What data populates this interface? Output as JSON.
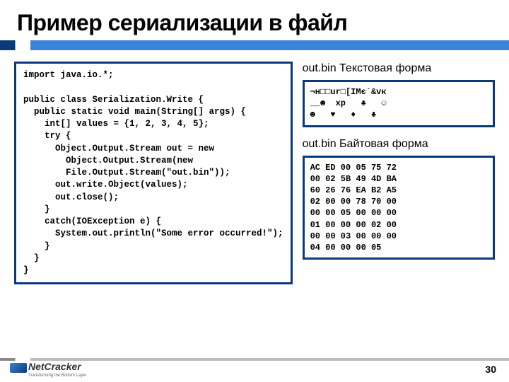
{
  "title": "Пример сериализации в файл",
  "code": "import java.io.*;\n\npublic class Serialization.Write {\n  public static void main(String[] args) {\n    int[] values = {1, 2, 3, 4, 5};\n    try {\n      Object.Output.Stream out = new\n        Object.Output.Stream(new\n        File.Output.Stream(\"out.bin\"));\n      out.write.Object(values);\n      out.close();\n    }\n    catch(IOException e) {\n      System.out.println(\"Some error occurred!\");\n    }\n  }\n}",
  "right": {
    "text_caption": "out.bin\nТекстовая форма",
    "text_dump": "¬н□□ur□[IMє`&vк\n__☻  xp   ♣   ☺\n☻   ♥   ♦   ♣",
    "byte_caption": "out.bin\nБайтовая форма",
    "byte_dump": "AC ED 00 05 75 72\n00 02 5B 49 4D BA\n60 26 76 EA B2 A5\n02 00 00 78 70 00\n00 00 05 00 00 00\n01 00 00 00 02 00\n00 00 03 00 00 00\n04 00 00 00 05"
  },
  "footer": {
    "brand": "NetCracker",
    "tagline": "Transforming the Bottom Layer",
    "page": "30"
  }
}
